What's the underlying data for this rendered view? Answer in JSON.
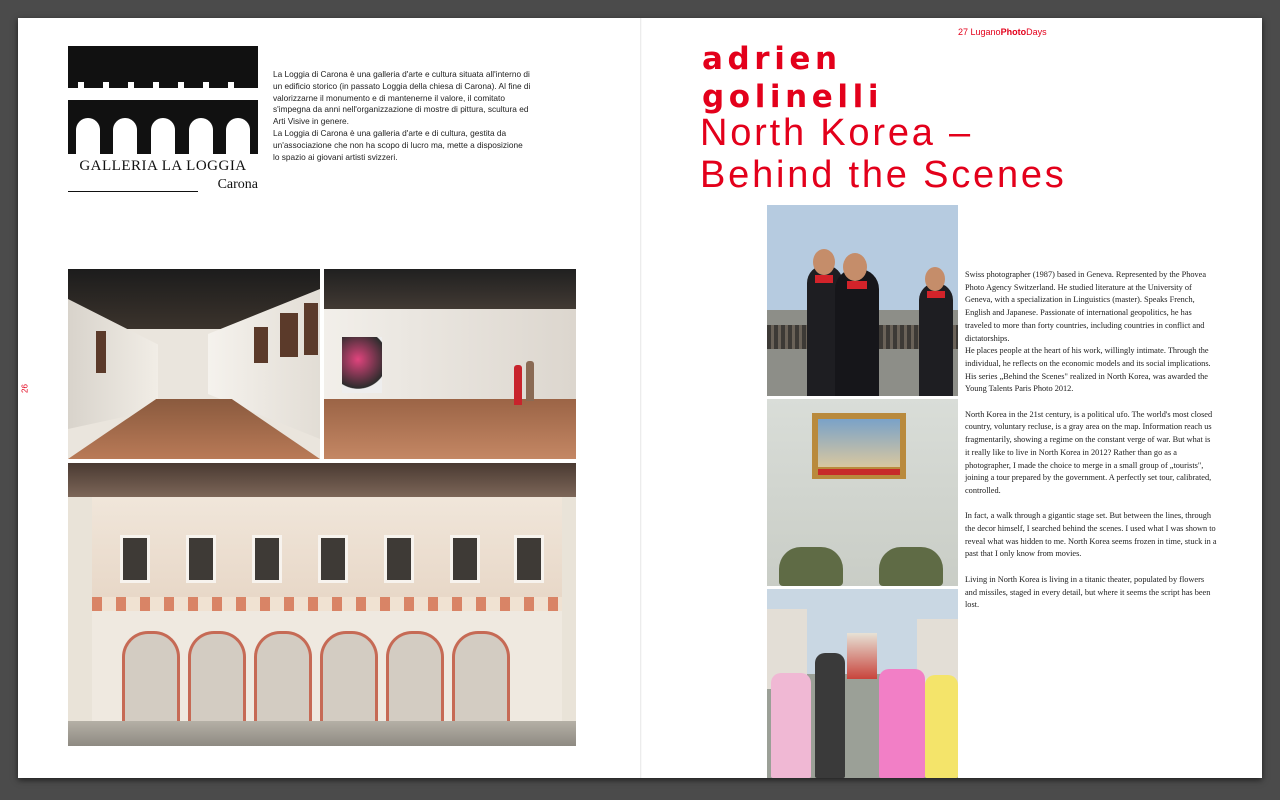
{
  "header": {
    "page_number_right": "27",
    "brand_prefix": "Lugano",
    "brand_bold": "Photo",
    "brand_suffix": "Days"
  },
  "left_page": {
    "page_number": "26",
    "logo": {
      "name": "GALLERIA LA LOGGIA",
      "place": "Carona"
    },
    "intro_paragraphs": [
      "La Loggia di Carona è una galleria d'arte e cultura situata all'interno di un edificio storico (in passato Loggia della chiesa di Carona). Al fine di valorizzarne il monumento e di mantenerne il valore, il comitato s'impegna da anni nell'organizzazione di mostre di pittura, scultura ed Arti Visive in genere.",
      "La Loggia di Carona è una galleria d'arte e di cultura, gestita da un'associazione che non ha scopo di lucro ma, mette a disposizione lo spazio ai giovani artisti svizzeri."
    ]
  },
  "right_page": {
    "author_first": "adrien",
    "author_last": "golinelli",
    "title_line1": "North Korea –",
    "title_line2": "Behind the Scenes",
    "bio_paragraphs": [
      "Swiss photographer (1987) based in Geneva. Represented by the Phovea Photo Agency Switzerland. He studied literature at the University of Geneva, with a specialization in Linguistics (master). Speaks French, English and Japanese. Passionate of international geopolitics, he has traveled to more than forty countries, including countries in conflict and dictatorships.",
      "He places people at the heart of his work, willingly intimate. Through the individual, he reflects on the economic models and its social implications. His series „Behind the Scenes\" realized in North Korea, was awarded the Young Talents Paris Photo 2012.",
      "North Korea in the 21st century, is a political ufo. The world's most closed country, voluntary recluse, is a gray area on the map. Information reach us fragmentarily, showing a regime on the constant verge of war. But what is it really like to live in North Korea in 2012? Rather than go as a photographer, I made the choice to merge in a small group of „tourists\", joining a tour prepared by the government. A perfectly set tour, calibrated, controlled.",
      "In fact, a walk through a gigantic stage set. But between the lines, through the decor himself, I searched behind the scenes. I used what I was shown to reveal what was hidden to me. North Korea seems frozen in time, stuck in a past that I only know from movies.",
      "Living in North Korea is living in a titanic theater, populated by flowers and missiles, staged in every detail, but where it seems the script has been lost."
    ]
  },
  "colors": {
    "accent": "#e3001b",
    "viewer_background": "#4b4b4b",
    "page": "#ffffff"
  }
}
